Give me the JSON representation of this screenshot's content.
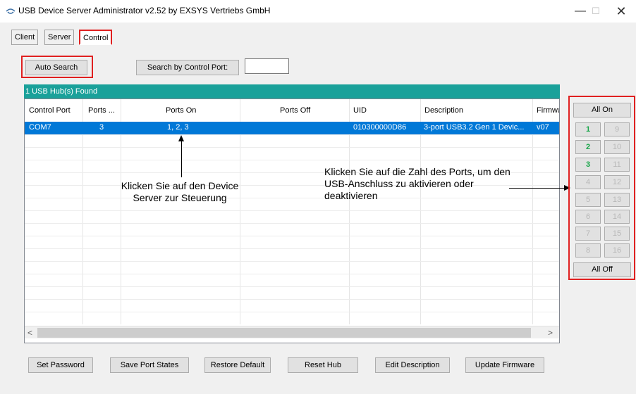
{
  "window": {
    "title": "USB Device Server Administrator v2.52 by EXSYS Vertriebs GmbH",
    "minimize_glyph": "—",
    "maximize_glyph": "☐",
    "close_glyph": "✕"
  },
  "tabs": [
    {
      "label": "Client"
    },
    {
      "label": "Server"
    },
    {
      "label": "Control"
    }
  ],
  "search": {
    "auto_search_label": "Auto Search",
    "search_port_label": "Search by Control Port:",
    "port_value": ""
  },
  "hub_bar": {
    "text": "1 USB Hub(s) Found"
  },
  "grid": {
    "columns": [
      "Control Port",
      "Ports ...",
      "Ports On",
      "Ports Off",
      "UID",
      "Description",
      "Firmwa"
    ],
    "rows": [
      {
        "control_port": "COM7",
        "ports": "3",
        "ports_on": "1, 2, 3",
        "ports_off": "",
        "uid": "010300000D86",
        "description": "3-port USB3.2 Gen 1 Devic...",
        "firmware": "v07"
      }
    ],
    "scroll_left": "<",
    "scroll_right": ">"
  },
  "annotations": {
    "left": "Klicken Sie auf den Device Server zur Steuerung",
    "right": "Klicken Sie auf die Zahl des Ports, um den USB-Anschluss zu aktivieren oder deaktivieren"
  },
  "port_panel": {
    "all_on_label": "All On",
    "all_off_label": "All Off",
    "ports": [
      {
        "label": "1",
        "active": true
      },
      {
        "label": "9",
        "active": false
      },
      {
        "label": "2",
        "active": true
      },
      {
        "label": "10",
        "active": false
      },
      {
        "label": "3",
        "active": true
      },
      {
        "label": "11",
        "active": false
      },
      {
        "label": "4",
        "active": false
      },
      {
        "label": "12",
        "active": false
      },
      {
        "label": "5",
        "active": false
      },
      {
        "label": "13",
        "active": false
      },
      {
        "label": "6",
        "active": false
      },
      {
        "label": "14",
        "active": false
      },
      {
        "label": "7",
        "active": false
      },
      {
        "label": "15",
        "active": false
      },
      {
        "label": "8",
        "active": false
      },
      {
        "label": "16",
        "active": false
      }
    ],
    "active_color": "#1aa64b",
    "inactive_color": "#b8b8b8"
  },
  "bottom_buttons": [
    {
      "label": "Set Password"
    },
    {
      "label": "Save Port States"
    },
    {
      "label": "Restore Default"
    },
    {
      "label": "Reset Hub"
    },
    {
      "label": "Edit Description"
    },
    {
      "label": "Update Firmware"
    }
  ],
  "colors": {
    "accent": "#1aa19a",
    "selection": "#0078d7",
    "highlight_box": "#e02020"
  }
}
